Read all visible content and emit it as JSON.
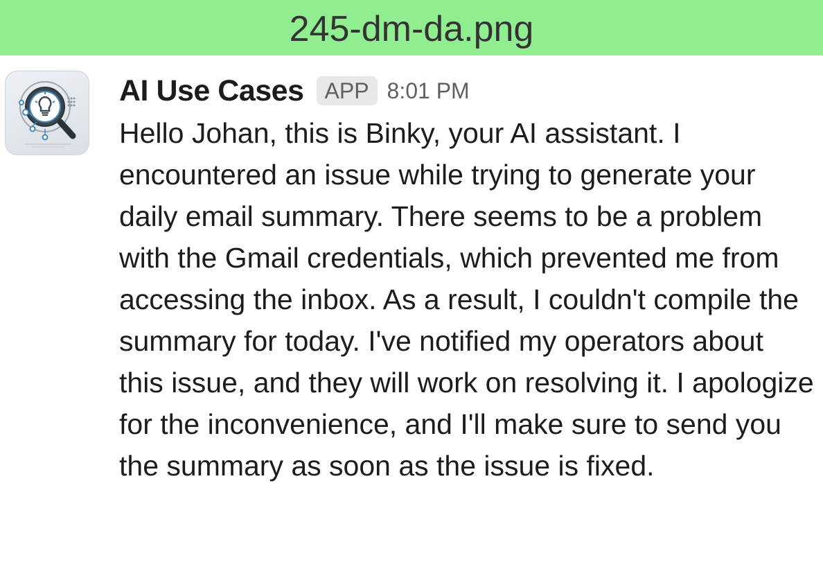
{
  "banner": {
    "filename": "245-dm-da.png",
    "color": "#90ee90"
  },
  "message": {
    "avatar_icon": "idea-lightbulb-magnifier-icon",
    "sender": "AI Use Cases",
    "badge": "APP",
    "time": "8:01 PM",
    "text": "Hello Johan, this is Binky, your AI assistant. I encountered an issue while trying to generate your daily email summary. There seems to be a problem with the Gmail credentials, which prevented me from accessing the inbox. As a result, I couldn't compile the summary for today. I've notified my operators about this issue, and they will work on resolving it. I apologize for the inconvenience, and I'll make sure to send you the summary as soon as the issue is fixed."
  }
}
